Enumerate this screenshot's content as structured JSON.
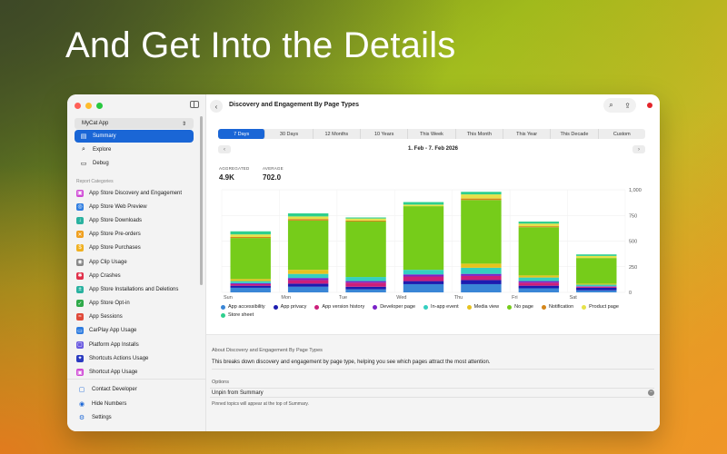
{
  "headline": "And Get Into the Details",
  "sidebar": {
    "app_selector": "MyCat App",
    "nav": [
      {
        "label": "Summary",
        "icon": "summary-icon",
        "glyph": "▤",
        "active": true
      },
      {
        "label": "Explore",
        "icon": "search-icon",
        "glyph": "⌕",
        "active": false
      },
      {
        "label": "Debug",
        "icon": "debug-icon",
        "glyph": "▭",
        "active": false
      }
    ],
    "categories_title": "Report Categories",
    "categories": [
      {
        "label": "App Store Discovery and Engagement",
        "color": "#d04ad6",
        "glyph": "▣"
      },
      {
        "label": "App Store Web Preview",
        "color": "#2f7de0",
        "glyph": "◎"
      },
      {
        "label": "App Store Downloads",
        "color": "#2ab2a0",
        "glyph": "↓"
      },
      {
        "label": "App Store Pre-orders",
        "color": "#f0a020",
        "glyph": "✕"
      },
      {
        "label": "App Store Purchases",
        "color": "#f0b020",
        "glyph": "$"
      },
      {
        "label": "App Clip Usage",
        "color": "#888888",
        "glyph": "◉"
      },
      {
        "label": "App Crashes",
        "color": "#e0304a",
        "glyph": "✱"
      },
      {
        "label": "App Store Installations and Deletions",
        "color": "#2ab2a0",
        "glyph": "±"
      },
      {
        "label": "App Store Opt-in",
        "color": "#2faa4a",
        "glyph": "✓"
      },
      {
        "label": "App Sessions",
        "color": "#e04a3a",
        "glyph": "≈"
      },
      {
        "label": "CarPlay App Usage",
        "color": "#2f7de0",
        "glyph": "▭"
      },
      {
        "label": "Platform App Installs",
        "color": "#6a5ae0",
        "glyph": "▢"
      },
      {
        "label": "Shortcuts Actions Usage",
        "color": "#2a3ac0",
        "glyph": "✦"
      },
      {
        "label": "Shortcut App Usage",
        "color": "#d04ad6",
        "glyph": "▣"
      }
    ],
    "footer": [
      {
        "label": "Contact Developer",
        "icon": "chat-bubble-icon",
        "glyph": "▢"
      },
      {
        "label": "Hide Numbers",
        "icon": "eye-slash-icon",
        "glyph": "◉"
      },
      {
        "label": "Settings",
        "icon": "gear-icon",
        "glyph": "⚙"
      }
    ]
  },
  "main": {
    "title": "Discovery and Engagement By Page Types",
    "periods": [
      "7 Days",
      "30 Days",
      "12 Months",
      "10 Years",
      "This Week",
      "This Month",
      "This Year",
      "This Decade",
      "Custom"
    ],
    "active_period": "7 Days",
    "date_range": "1. Feb - 7. Feb 2026",
    "stats": [
      {
        "label": "AGGREGATED",
        "value": "4.9K"
      },
      {
        "label": "AVERAGE",
        "value": "702.0"
      }
    ],
    "legend": [
      {
        "name": "App accessibility",
        "color": "#3a86d6"
      },
      {
        "name": "App privacy",
        "color": "#1c1cb0"
      },
      {
        "name": "App version history",
        "color": "#cc1f7a"
      },
      {
        "name": "Developer page",
        "color": "#7a22c8"
      },
      {
        "name": "In-app event",
        "color": "#34cfc0"
      },
      {
        "name": "Media view",
        "color": "#e6c21e"
      },
      {
        "name": "No page",
        "color": "#76cc1a"
      },
      {
        "name": "Notification",
        "color": "#d4861a"
      },
      {
        "name": "Product page",
        "color": "#e6e24a"
      },
      {
        "name": "Store sheet",
        "color": "#2ecf8e"
      }
    ],
    "about_title": "About Discovery and Engagement By Page Types",
    "about_text": "This breaks down discovery and engagement by page type, helping you see which pages attract the most attention.",
    "options_title": "Options",
    "unpin_label": "Unpin from Summary",
    "pinned_note": "Pinned topics will appear at the top of Summary."
  },
  "chart_data": {
    "type": "bar",
    "stacked": true,
    "categories": [
      "Sun",
      "Mon",
      "Tue",
      "Wed",
      "Thu",
      "Fri",
      "Sat"
    ],
    "ylim": [
      0,
      1000
    ],
    "yticks": [
      0,
      250,
      500,
      750,
      1000
    ],
    "ytick_labels": [
      "0",
      "250",
      "500",
      "750",
      "1,000"
    ],
    "grid": true,
    "legend_position": "bottom",
    "series": [
      {
        "name": "App accessibility",
        "values": [
          45,
          55,
          30,
          80,
          80,
          40,
          20
        ]
      },
      {
        "name": "App privacy",
        "values": [
          20,
          30,
          25,
          30,
          40,
          25,
          25
        ]
      },
      {
        "name": "App version history",
        "values": [
          15,
          35,
          40,
          45,
          40,
          30,
          10
        ]
      },
      {
        "name": "Developer page",
        "values": [
          10,
          20,
          15,
          20,
          20,
          15,
          5
        ]
      },
      {
        "name": "In-app event",
        "values": [
          20,
          40,
          40,
          45,
          60,
          35,
          15
        ]
      },
      {
        "name": "Media view",
        "values": [
          20,
          40,
          0,
          0,
          40,
          20,
          10
        ]
      },
      {
        "name": "No page",
        "values": [
          400,
          480,
          540,
          620,
          620,
          470,
          250
        ]
      },
      {
        "name": "Notification",
        "values": [
          10,
          15,
          10,
          0,
          15,
          10,
          0
        ]
      },
      {
        "name": "Product page",
        "values": [
          25,
          25,
          20,
          15,
          40,
          25,
          20
        ]
      },
      {
        "name": "Store sheet",
        "values": [
          30,
          30,
          10,
          25,
          25,
          20,
          15
        ]
      }
    ]
  }
}
